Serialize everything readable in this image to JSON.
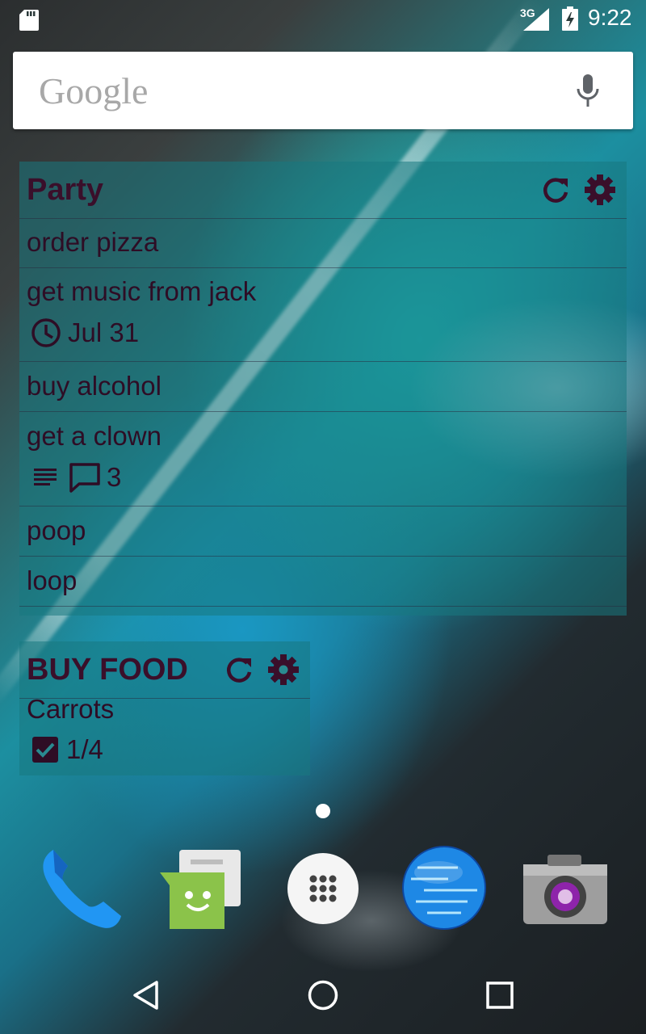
{
  "status_bar": {
    "network": "3G",
    "time": "9:22",
    "icons": [
      "sd-card-icon",
      "signal-icon",
      "battery-charging-icon"
    ]
  },
  "search": {
    "brand": "Google",
    "icons": [
      "mic-icon"
    ]
  },
  "widgets": [
    {
      "title": "Party",
      "header_icons": [
        "refresh-icon",
        "gear-icon"
      ],
      "items": [
        {
          "text": "order pizza"
        },
        {
          "text": "get music from jack",
          "due": "Jul 31",
          "meta_icon": "clock-icon"
        },
        {
          "text": "buy alcohol"
        },
        {
          "text": "get a clown",
          "comments": "3",
          "meta_icons": [
            "notes-icon",
            "comment-icon"
          ]
        },
        {
          "text": "poop"
        },
        {
          "text": "loop"
        }
      ]
    },
    {
      "title": "BUY FOOD",
      "header_icons": [
        "refresh-icon",
        "gear-icon"
      ],
      "items": [
        {
          "text": "Carrots",
          "subtasks": "1/4",
          "meta_icon": "checkbox-icon"
        }
      ]
    }
  ],
  "dock": [
    "phone-icon",
    "messenger-icon",
    "app-drawer-icon",
    "browser-globe-icon",
    "camera-icon"
  ],
  "navigation": [
    "back-icon",
    "home-icon",
    "recents-icon"
  ],
  "colors": {
    "widget_text": "#2e0d25",
    "widget_background": "#187880"
  }
}
